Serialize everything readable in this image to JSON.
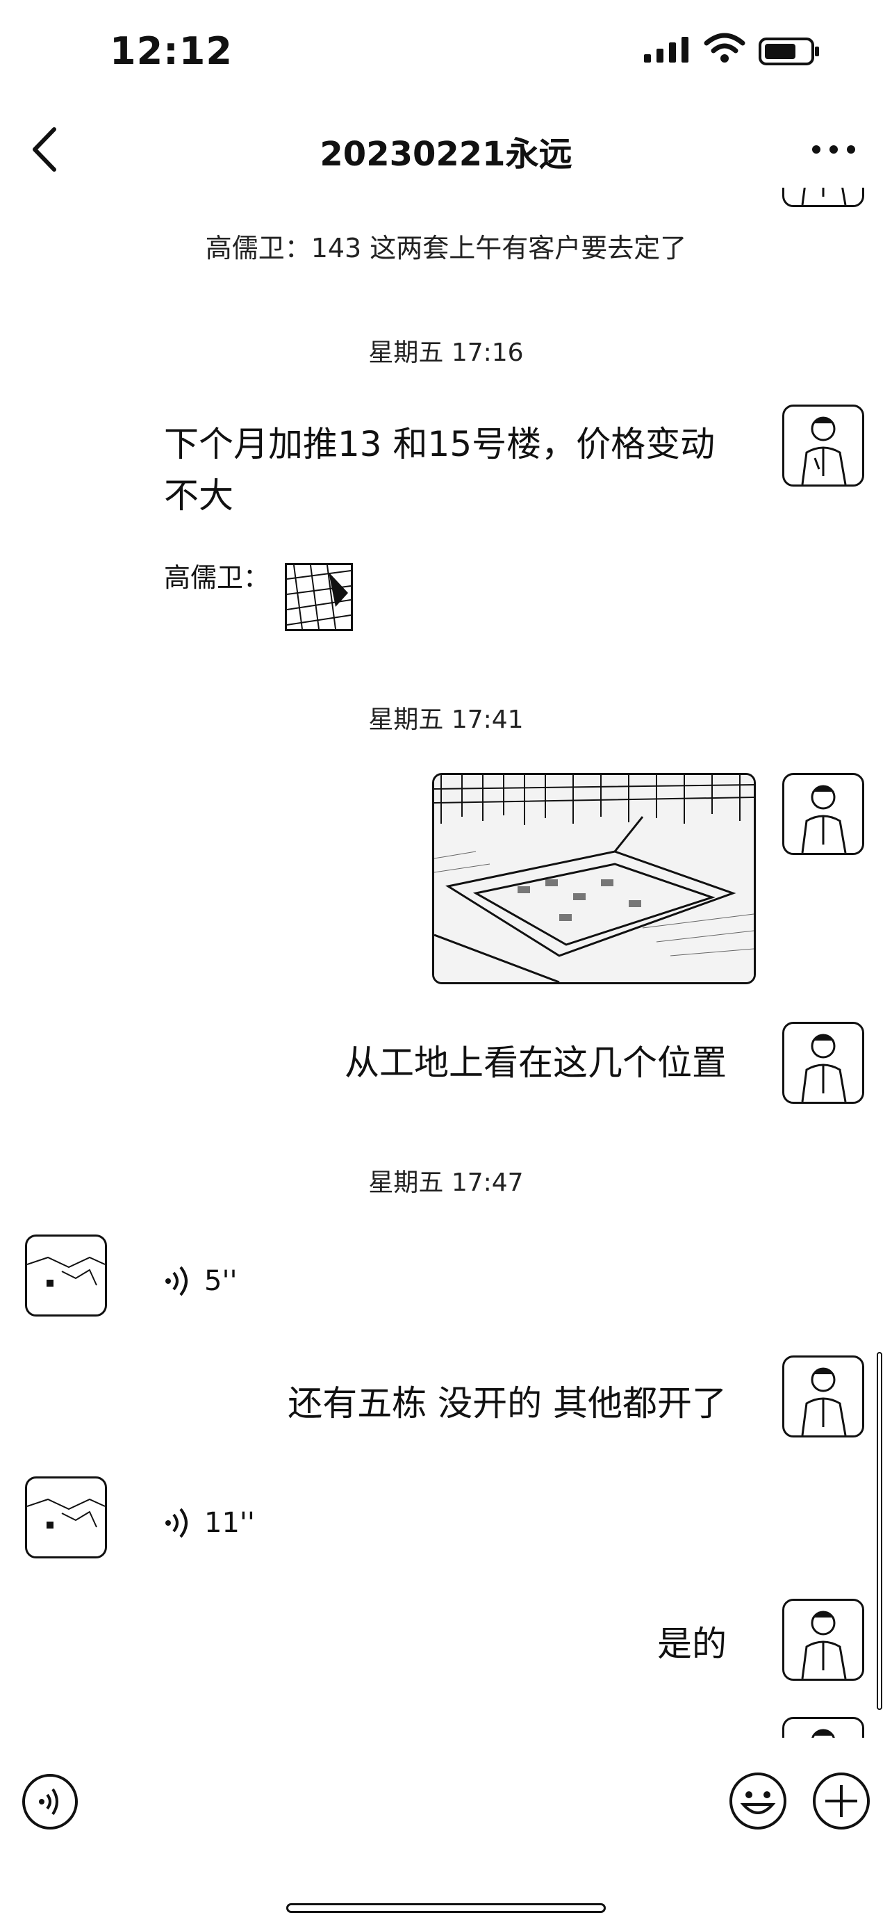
{
  "status_bar": {
    "time": "12:12"
  },
  "nav": {
    "title": "20230221永远"
  },
  "chat": {
    "system_line": "高儒卫：143 这两套上午有客户要去定了",
    "timestamps": [
      "星期五 17:16",
      "星期五 17:41",
      "星期五 17:47"
    ],
    "messages": {
      "m1": "下个月加推13 和15号楼，价格变动不大",
      "m1_sender_label": "高儒卫：",
      "m2": "从工地上看在这几个位置",
      "v1": "5''",
      "m3": "还有五栋 没开的 其他都开了",
      "v2": "11''",
      "m4": "是的"
    }
  },
  "icons": {
    "back": "chevron-left-icon",
    "more": "more-dots-icon",
    "voice": "voice-wave-icon",
    "emoji": "emoji-icon",
    "plus": "plus-icon"
  }
}
